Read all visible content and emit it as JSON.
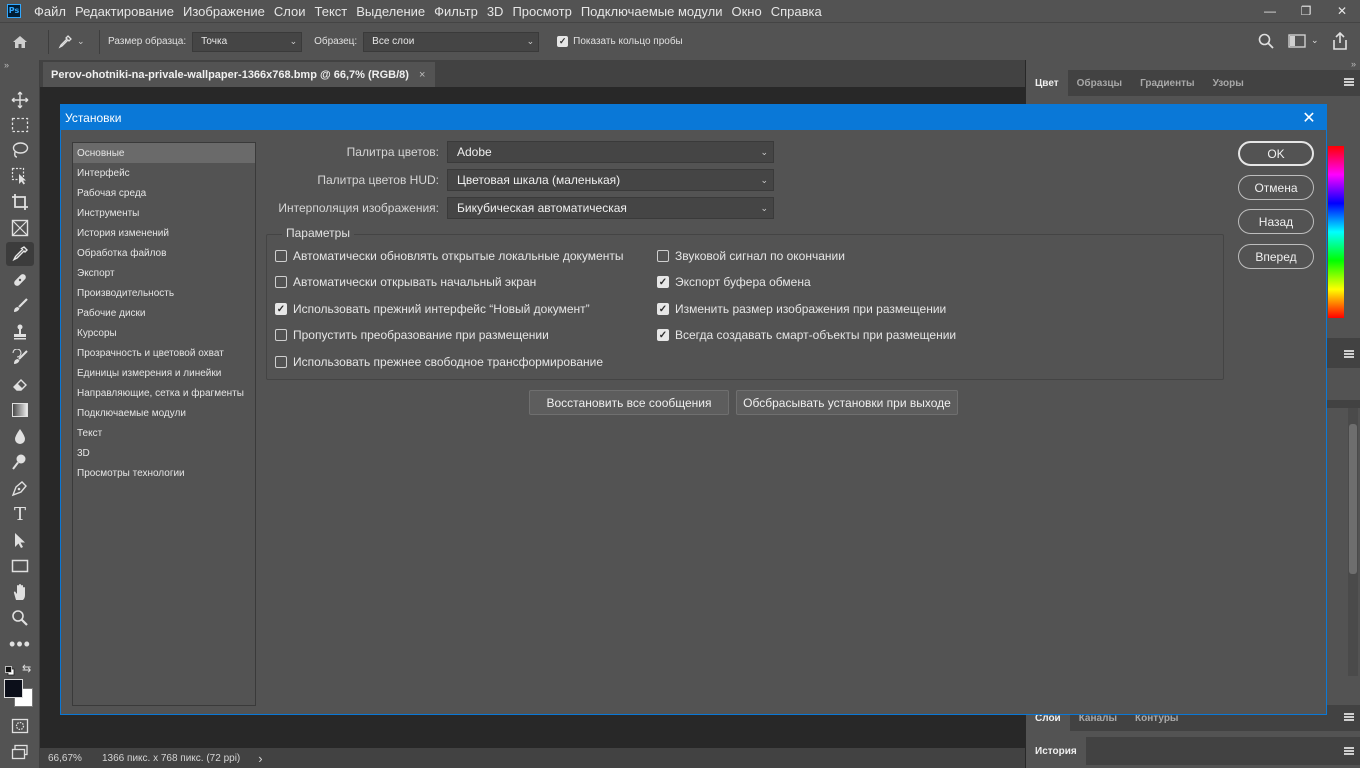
{
  "menubar": {
    "items": [
      "Файл",
      "Редактирование",
      "Изображение",
      "Слои",
      "Текст",
      "Выделение",
      "Фильтр",
      "3D",
      "Просмотр",
      "Подключаемые модули",
      "Окно",
      "Справка"
    ],
    "logo_text": "Ps"
  },
  "optbar": {
    "sample_size_label": "Размер образца:",
    "sample_size_value": "Точка",
    "sample_label": "Образец:",
    "sample_value": "Все слои",
    "show_ring_label": "Показать кольцо пробы",
    "show_ring_checked": true
  },
  "document": {
    "tab_title": "Perov-ohotniki-na-privale-wallpaper-1366x768.bmp @ 66,7% (RGB/8)",
    "close_glyph": "×"
  },
  "status": {
    "zoom": "66,67%",
    "info": "1366 пикс. x 768 пикс. (72 ppi)",
    "arrow": "›"
  },
  "panels": {
    "top_tabs": [
      "Цвет",
      "Образцы",
      "Градиенты",
      "Узоры"
    ],
    "layers_tabs": [
      "Слои",
      "Каналы",
      "Контуры"
    ],
    "history_tab": "История"
  },
  "dialog": {
    "title": "Установки",
    "close_glyph": "✕",
    "nav": [
      "Основные",
      "Интерфейс",
      "Рабочая среда",
      "Инструменты",
      "История изменений",
      "Обработка файлов",
      "Экспорт",
      "Производительность",
      "Рабочие диски",
      "Курсоры",
      "Прозрачность и цветовой охват",
      "Единицы измерения и линейки",
      "Направляющие, сетка и фрагменты",
      "Подключаемые модули",
      "Текст",
      "3D",
      "Просмотры технологии"
    ],
    "nav_active": 0,
    "fields": {
      "color_picker_label": "Палитра цветов:",
      "color_picker_value": "Adobe",
      "hud_picker_label": "Палитра цветов HUD:",
      "hud_picker_value": "Цветовая шкала (маленькая)",
      "interp_label": "Интерполяция изображения:",
      "interp_value": "Бикубическая автоматическая"
    },
    "params_title": "Параметры",
    "options_left": [
      {
        "label": "Автоматически обновлять открытые локальные документы",
        "checked": false
      },
      {
        "label": "Автоматически открывать начальный экран",
        "checked": false
      },
      {
        "label": "Использовать прежний интерфейс “Новый документ”",
        "checked": true
      },
      {
        "label": "Пропустить преобразование при размещении",
        "checked": false
      },
      {
        "label": "Использовать прежнее свободное трансформирование",
        "checked": false
      }
    ],
    "options_right": [
      {
        "label": "Звуковой сигнал по окончании",
        "checked": false
      },
      {
        "label": "Экспорт буфера обмена",
        "checked": true
      },
      {
        "label": "Изменить размер изображения при размещении",
        "checked": true
      },
      {
        "label": "Всегда создавать смарт-объекты при размещении",
        "checked": true
      }
    ],
    "reset_messages_btn": "Восстановить все сообщения",
    "reset_on_exit_btn": "Обсбрасывать установки при выходе",
    "ok_btn": "OK",
    "cancel_btn": "Отмена",
    "back_btn": "Назад",
    "forward_btn": "Вперед"
  },
  "colors": {
    "accent": "#0a78d7",
    "panel_bg": "#535353",
    "canvas_bg": "#282828"
  }
}
